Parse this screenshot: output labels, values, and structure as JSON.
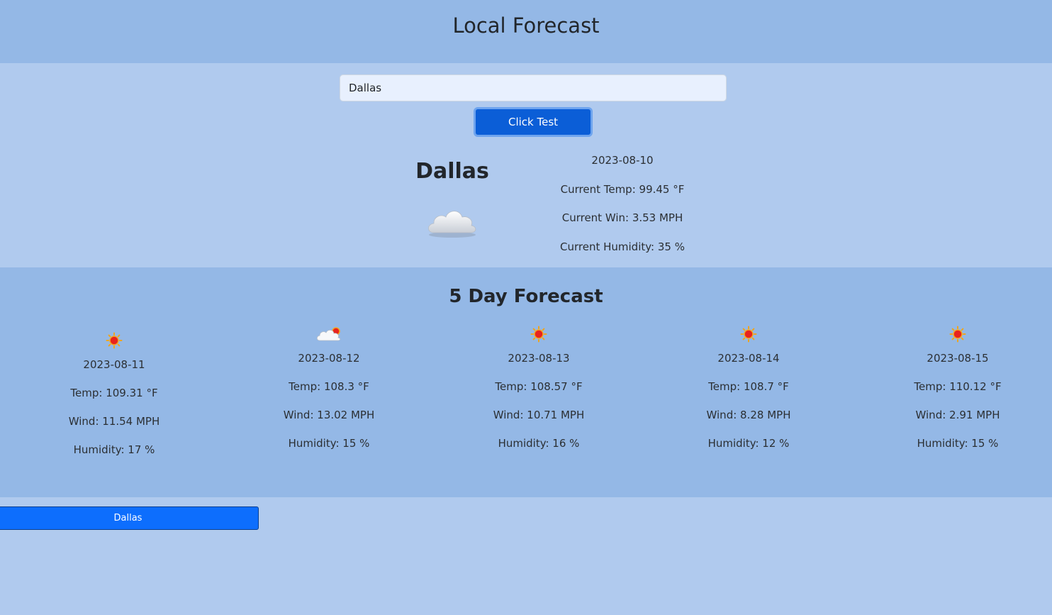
{
  "header": {
    "title": "Local Forecast"
  },
  "search": {
    "value": "Dallas",
    "button_label": "Click Test"
  },
  "current": {
    "city": "Dallas",
    "icon": "cloud-icon",
    "date": "2023-08-10",
    "temp": "Current Temp: 99.45 °F",
    "wind": "Current Win: 3.53 MPH",
    "humidity": "Current Humidity: 35 %"
  },
  "forecast": {
    "title": "5 Day Forecast",
    "days": [
      {
        "icon": "sun-icon",
        "date": "2023-08-11",
        "temp": "Temp: 109.31 °F",
        "wind": "Wind: 11.54 MPH",
        "humidity": "Humidity: 17 %"
      },
      {
        "icon": "sun-behind-cloud-icon",
        "date": "2023-08-12",
        "temp": "Temp: 108.3 °F",
        "wind": "Wind: 13.02 MPH",
        "humidity": "Humidity: 15 %"
      },
      {
        "icon": "sun-icon",
        "date": "2023-08-13",
        "temp": "Temp: 108.57 °F",
        "wind": "Wind: 10.71 MPH",
        "humidity": "Humidity: 16 %"
      },
      {
        "icon": "sun-icon",
        "date": "2023-08-14",
        "temp": "Temp: 108.7 °F",
        "wind": "Wind: 8.28 MPH",
        "humidity": "Humidity: 12 %"
      },
      {
        "icon": "sun-icon",
        "date": "2023-08-15",
        "temp": "Temp: 110.12 °F",
        "wind": "Wind: 2.91 MPH",
        "humidity": "Humidity: 15 %"
      }
    ]
  },
  "history": [
    {
      "label": "Dallas"
    }
  ],
  "colors": {
    "page_bg": "#b0caee",
    "band_bg": "#94b8e6",
    "primary_button": "#0b5ed7",
    "history_button": "#0d6efd"
  }
}
